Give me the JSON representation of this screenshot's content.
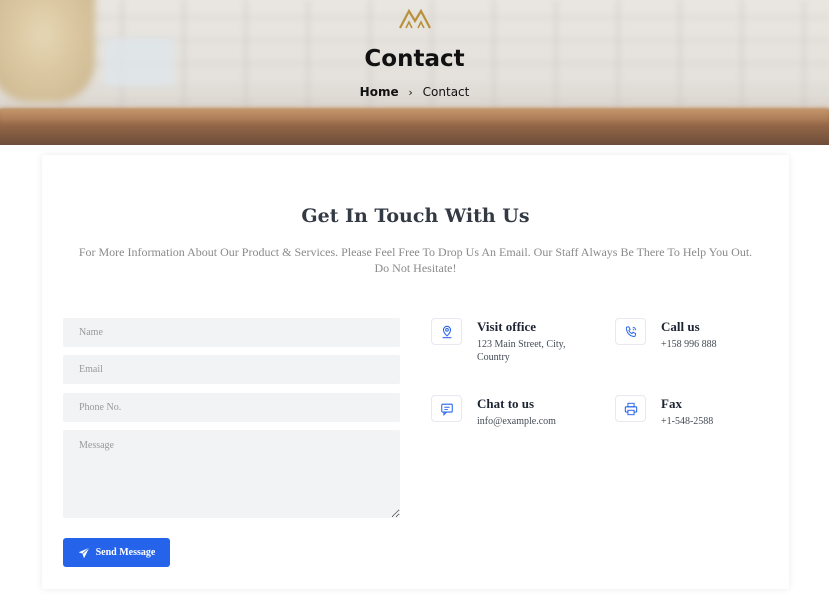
{
  "hero": {
    "title": "Contact",
    "breadcrumb": {
      "home": "Home",
      "separator": "›",
      "current": "Contact"
    },
    "logo_color": "#b8913a"
  },
  "section": {
    "heading": "Get In Touch With Us",
    "intro": "For More Information About Our Product & Services. Please Feel Free To Drop Us An Email. Our Staff Always Be There To Help You Out. Do Not Hesitate!"
  },
  "form": {
    "name_placeholder": "Name",
    "email_placeholder": "Email",
    "phone_placeholder": "Phone No.",
    "message_placeholder": "Message",
    "submit_label": "Send Message",
    "submit_icon": "paper-plane-icon",
    "accent": "#2563eb"
  },
  "contact_info": [
    {
      "icon": "map-pin-icon",
      "title": "Visit office",
      "value": "123 Main Street, City, Country"
    },
    {
      "icon": "phone-icon",
      "title": "Call us",
      "value": "+158 996 888"
    },
    {
      "icon": "chat-icon",
      "title": "Chat to us",
      "value": "info@example.com"
    },
    {
      "icon": "printer-icon",
      "title": "Fax",
      "value": "+1-548-2588"
    }
  ]
}
